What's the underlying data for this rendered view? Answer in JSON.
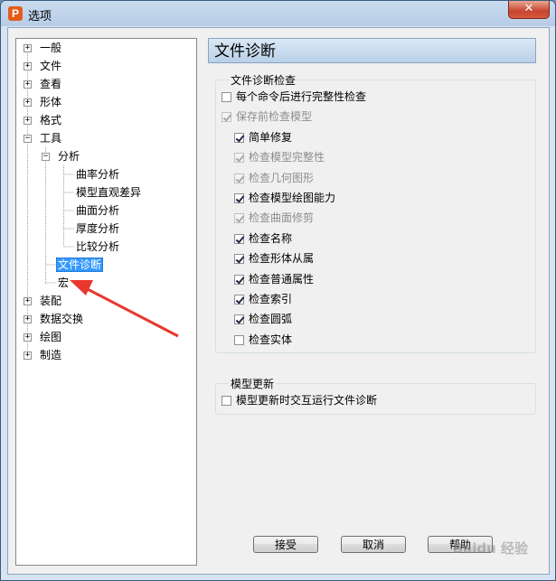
{
  "window": {
    "title": "选项",
    "app_icon_letter": "P",
    "close_glyph": "✕"
  },
  "tree": [
    {
      "label": "一般",
      "expander": "+"
    },
    {
      "label": "文件",
      "expander": "+"
    },
    {
      "label": "查看",
      "expander": "+"
    },
    {
      "label": "形体",
      "expander": "+"
    },
    {
      "label": "格式",
      "expander": "+"
    },
    {
      "label": "工具",
      "expander": "−"
    },
    {
      "label": "分析",
      "expander": "−"
    },
    {
      "label": "曲率分析"
    },
    {
      "label": "模型直观差异"
    },
    {
      "label": "曲面分析"
    },
    {
      "label": "厚度分析"
    },
    {
      "label": "比较分析"
    },
    {
      "label": "文件诊断",
      "selected": true
    },
    {
      "label": "宏"
    },
    {
      "label": "装配",
      "expander": "+"
    },
    {
      "label": "数据交换",
      "expander": "+"
    },
    {
      "label": "绘图",
      "expander": "+"
    },
    {
      "label": "制造",
      "expander": "+"
    }
  ],
  "page": {
    "title": "文件诊断",
    "check_group": {
      "title": "文件诊断检查",
      "items": [
        {
          "label": "每个命令后进行完整性检查",
          "checked": false,
          "disabled": false
        },
        {
          "label": "保存前检查模型",
          "checked": true,
          "disabled": true
        },
        {
          "label": "简单修复",
          "checked": true,
          "disabled": false
        },
        {
          "label": "检查模型完整性",
          "checked": true,
          "disabled": true
        },
        {
          "label": "检查几何图形",
          "checked": true,
          "disabled": true
        },
        {
          "label": "检查模型绘图能力",
          "checked": true,
          "disabled": false
        },
        {
          "label": "检查曲面修剪",
          "checked": true,
          "disabled": true
        },
        {
          "label": "检查名称",
          "checked": true,
          "disabled": false
        },
        {
          "label": "检查形体从属",
          "checked": true,
          "disabled": false
        },
        {
          "label": "检查普通属性",
          "checked": true,
          "disabled": false
        },
        {
          "label": "检查索引",
          "checked": true,
          "disabled": false
        },
        {
          "label": "检查圆弧",
          "checked": true,
          "disabled": false
        },
        {
          "label": "检查实体",
          "checked": false,
          "disabled": false
        }
      ]
    },
    "update_group": {
      "title": "模型更新",
      "items": [
        {
          "label": "模型更新时交互运行文件诊断",
          "checked": false,
          "disabled": false
        }
      ]
    }
  },
  "buttons": {
    "accept": "接受",
    "cancel": "取消",
    "help": "帮助"
  },
  "watermark": "Baidu 经验",
  "colors": {
    "selection": "#3399ff",
    "arrow": "#e8372e",
    "header_gradient_top": "#dbe8f5"
  }
}
